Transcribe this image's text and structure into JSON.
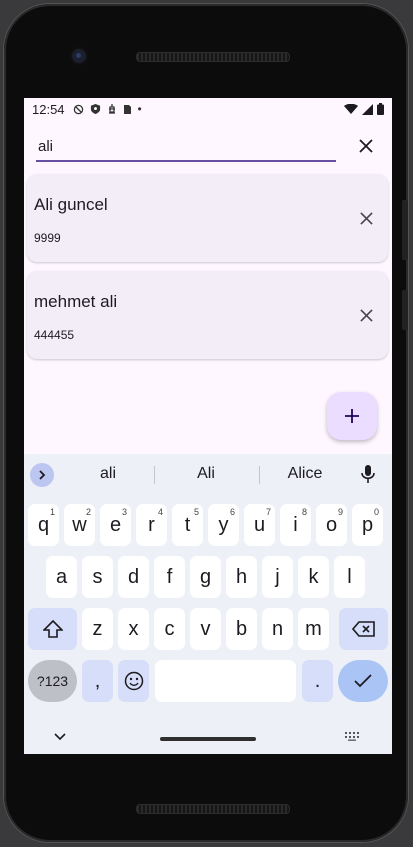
{
  "status": {
    "time": "12:54"
  },
  "search": {
    "value": "ali",
    "placeholder": ""
  },
  "contacts": [
    {
      "name": "Ali guncel",
      "phone": "9999"
    },
    {
      "name": "mehmet ali",
      "phone": "444455"
    }
  ],
  "fab": {
    "label": "+"
  },
  "keyboard": {
    "suggestions": [
      "ali",
      "Ali",
      "Alice"
    ],
    "row1": [
      {
        "k": "q",
        "n": "1"
      },
      {
        "k": "w",
        "n": "2"
      },
      {
        "k": "e",
        "n": "3"
      },
      {
        "k": "r",
        "n": "4"
      },
      {
        "k": "t",
        "n": "5"
      },
      {
        "k": "y",
        "n": "6"
      },
      {
        "k": "u",
        "n": "7"
      },
      {
        "k": "i",
        "n": "8"
      },
      {
        "k": "o",
        "n": "9"
      },
      {
        "k": "p",
        "n": "0"
      }
    ],
    "row2": [
      "a",
      "s",
      "d",
      "f",
      "g",
      "h",
      "j",
      "k",
      "l"
    ],
    "row3": [
      "z",
      "x",
      "c",
      "v",
      "b",
      "n",
      "m"
    ],
    "sym_label": "?123",
    "comma": ",",
    "period": "."
  },
  "colors": {
    "accent": "#6750a4",
    "card": "#f3edf7",
    "fab": "#eaddff",
    "screen": "#fef7ff"
  }
}
